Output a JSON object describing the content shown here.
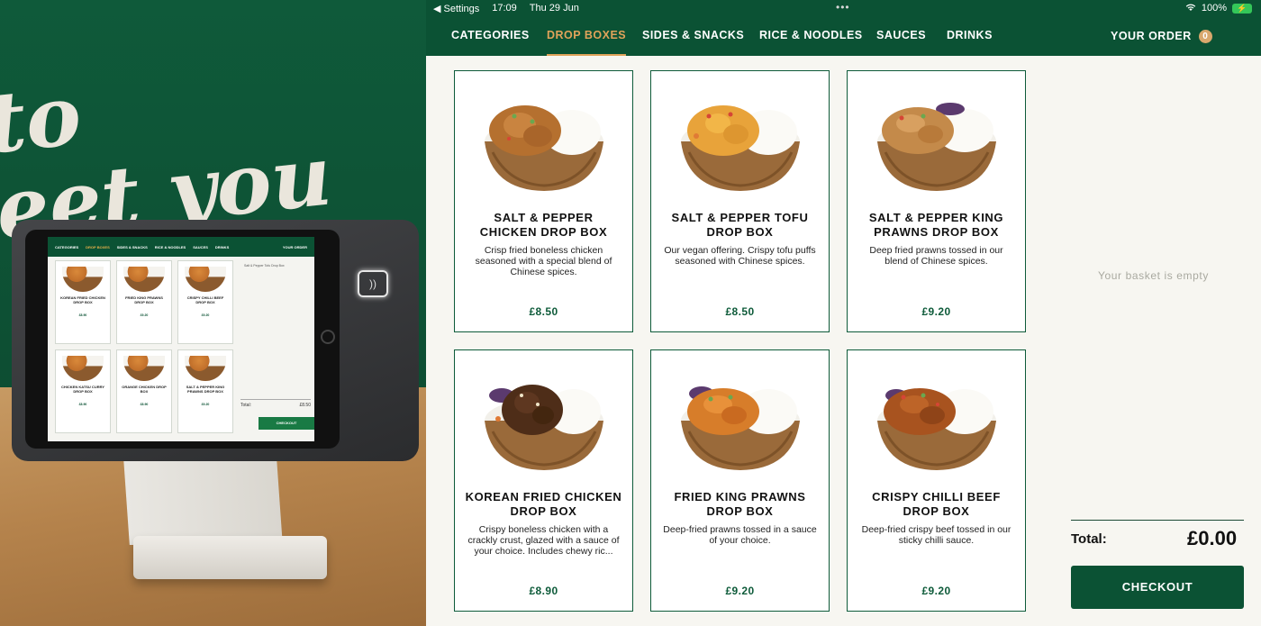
{
  "status_bar": {
    "back_label": "◀ Settings",
    "time": "17:09",
    "date": "Thu 29 Jun",
    "battery": "100%"
  },
  "nav": {
    "tabs": [
      {
        "label": "CATEGORIES"
      },
      {
        "label": "DROP BOXES"
      },
      {
        "label": "SIDES & SNACKS"
      },
      {
        "label": "RICE & NOODLES"
      },
      {
        "label": "SAUCES"
      },
      {
        "label": "DRINKS"
      }
    ],
    "active_tab": "DROP BOXES",
    "your_order_label": "YOUR ORDER",
    "order_count": "0"
  },
  "products": [
    {
      "name": "SALT & PEPPER CHICKEN DROP BOX",
      "description": "Crisp fried boneless chicken seasoned with a special blend of Chinese spices.",
      "price": "£8.50"
    },
    {
      "name": "SALT & PEPPER TOFU DROP BOX",
      "description": "Our vegan offering. Crispy tofu puffs seasoned with Chinese spices.",
      "price": "£8.50"
    },
    {
      "name": "SALT & PEPPER KING PRAWNS DROP BOX",
      "description": "Deep fried prawns tossed in our blend of Chinese spices.",
      "price": "£9.20"
    },
    {
      "name": "KOREAN FRIED CHICKEN DROP BOX",
      "description": "Crispy boneless chicken with a crackly crust, glazed with a sauce of your choice. Includes chewy ric...",
      "price": "£8.90"
    },
    {
      "name": "FRIED KING PRAWNS DROP BOX",
      "description": "Deep-fried prawns tossed in a sauce of your choice.",
      "price": "£9.20"
    },
    {
      "name": "CRISPY CHILLI BEEF DROP BOX",
      "description": "Deep-fried crispy beef tossed in our sticky chilli sauce.",
      "price": "£9.20"
    }
  ],
  "basket": {
    "empty_text": "Your basket is empty",
    "total_label": "Total:",
    "total_value": "£0.00",
    "checkout_label": "CHECKOUT"
  },
  "photo": {
    "wall_text": "to\neet you",
    "mini_tabs": [
      "CATEGORIES",
      "DROP BOXES",
      "SIDES & SNACKS",
      "RICE & NOODLES",
      "SAUCES",
      "DRINKS"
    ],
    "mini_your_order": "YOUR ORDER",
    "mini_products": [
      {
        "name": "KOREAN FRIED CHICKEN DROP BOX",
        "price": "£8.90"
      },
      {
        "name": "FRIED KING PRAWNS DROP BOX",
        "price": "£9.20"
      },
      {
        "name": "CRISPY CHILLI BEEF DROP BOX",
        "price": "£9.20"
      },
      {
        "name": "CHICKEN KATSU CURRY DROP BOX",
        "price": "£8.90"
      },
      {
        "name": "ORANGE CHICKEN DROP BOX",
        "price": "£8.90"
      },
      {
        "name": "SALT & PEPPER KING PRAWNS DROP BOX",
        "price": "£9.20"
      }
    ],
    "mini_basket_item": "Salt & Pepper Tofu Drop Box",
    "mini_total_label": "Total:",
    "mini_total_value": "£8.50",
    "mini_checkout": "CHECKOUT"
  },
  "colors": {
    "brand_green": "#0b5234",
    "active_tab": "#e0a35a",
    "price_green": "#0e5b3a"
  }
}
